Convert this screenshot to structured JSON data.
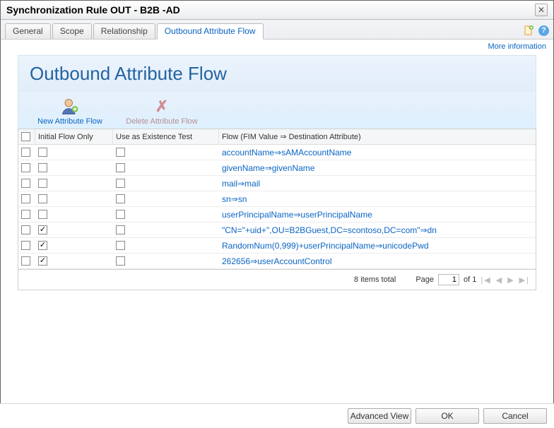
{
  "window": {
    "title": "Synchronization Rule OUT - B2B -AD"
  },
  "tabs": [
    {
      "label": "General",
      "active": false
    },
    {
      "label": "Scope",
      "active": false
    },
    {
      "label": "Relationship",
      "active": false
    },
    {
      "label": "Outbound Attribute Flow",
      "active": true
    }
  ],
  "more_info": "More information",
  "section_title": "Outbound Attribute Flow",
  "toolbar": {
    "new_flow": "New Attribute Flow",
    "delete_flow": "Delete Attribute Flow"
  },
  "columns": {
    "initial_flow": "Initial Flow Only",
    "existence_test": "Use as Existence Test",
    "flow": "Flow (FIM Value ⇒ Destination Attribute)"
  },
  "rows": [
    {
      "selected": false,
      "initial": false,
      "existence": false,
      "flow": "accountName⇒sAMAccountName"
    },
    {
      "selected": false,
      "initial": false,
      "existence": false,
      "flow": "givenName⇒givenName"
    },
    {
      "selected": false,
      "initial": false,
      "existence": false,
      "flow": "mail⇒mail"
    },
    {
      "selected": false,
      "initial": false,
      "existence": false,
      "flow": "sn⇒sn"
    },
    {
      "selected": false,
      "initial": false,
      "existence": false,
      "flow": "userPrincipalName⇒userPrincipalName"
    },
    {
      "selected": false,
      "initial": true,
      "existence": false,
      "flow": "\"CN=\"+uid+\",OU=B2BGuest,DC=scontoso,DC=com\"⇒dn"
    },
    {
      "selected": false,
      "initial": true,
      "existence": false,
      "flow": "RandomNum(0,999)+userPrincipalName⇒unicodePwd"
    },
    {
      "selected": false,
      "initial": true,
      "existence": false,
      "flow": "262656⇒userAccountControl"
    }
  ],
  "pager": {
    "total": "8 items total",
    "page_label": "Page",
    "page_value": "1",
    "page_of": "of 1"
  },
  "footer": {
    "advanced": "Advanced View",
    "ok": "OK",
    "cancel": "Cancel"
  }
}
